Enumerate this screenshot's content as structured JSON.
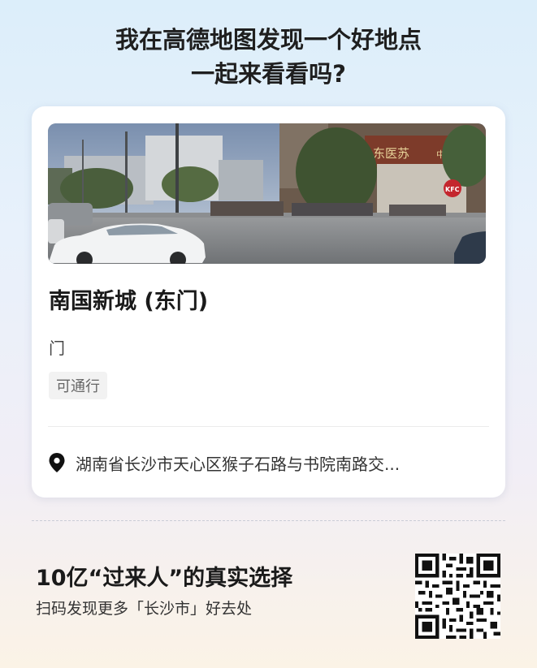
{
  "headline": {
    "line1": "我在高德地图发现一个好地点",
    "line2": "一起来看看吗?"
  },
  "poi_card": {
    "name": "南国新城 (东门)",
    "category": "门",
    "tag": "可通行",
    "address": "湖南省长沙市天心区猴子石路与书院南路交...",
    "photo": {
      "sign_text": "东医苏",
      "sign_sub": "中心",
      "logo": "KFC"
    }
  },
  "promo": {
    "title": "10亿“过来人”的真实选择",
    "subtitle": "扫码发现更多「长沙市」好去处"
  },
  "icons": {
    "location": "location-pin-icon",
    "qr": "qr-code"
  },
  "colors": {
    "text_primary": "#1a1a1a",
    "tag_bg": "#f2f2f2",
    "card_bg": "#ffffff"
  }
}
